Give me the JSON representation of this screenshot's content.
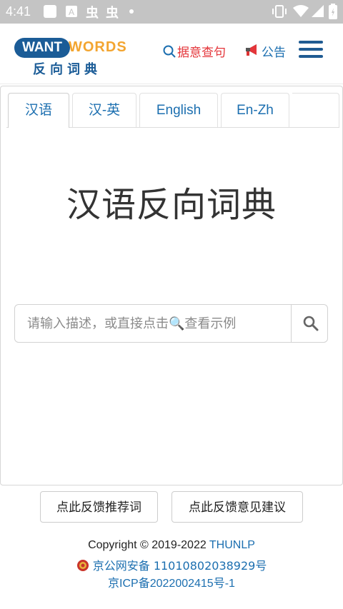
{
  "status_bar": {
    "time": "4:41",
    "icons": [
      "square-icon",
      "font-a-icon",
      "bug-icon",
      "bug-icon",
      "dot-icon",
      "vibrate-icon",
      "wifi-icon",
      "signal-icon",
      "battery-icon"
    ]
  },
  "header": {
    "logo": {
      "want": "WANT",
      "words": "WORDS",
      "cn": "反向词典"
    },
    "help_link": "据意查句",
    "notice_link": "公告",
    "colors": {
      "brand_blue": "#1b5c97",
      "brand_orange": "#f3a530",
      "help_red": "#e4353a",
      "link_blue": "#1c6fb0"
    }
  },
  "tabs": [
    {
      "label": "汉语",
      "active": true
    },
    {
      "label": "汉-英",
      "active": false
    },
    {
      "label": "English",
      "active": false
    },
    {
      "label": "En-Zh",
      "active": false
    }
  ],
  "main": {
    "title": "汉语反向词典",
    "search": {
      "placeholder": "请输入描述，或直接点击🔍查看示例",
      "value": ""
    }
  },
  "feedback": {
    "recommend": "点此反馈推荐词",
    "suggestion": "点此反馈意见建议"
  },
  "footer": {
    "copyright": "Copyright © 2019-2022",
    "org": "THUNLP",
    "beian": "京公网安备 11010802038929号",
    "icp": "京ICP备2022002415号-1"
  }
}
